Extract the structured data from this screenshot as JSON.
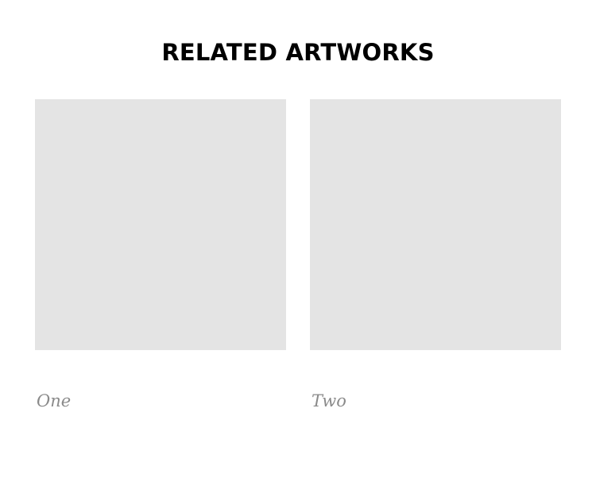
{
  "related": {
    "title": "RELATED ARTWORKS",
    "items": [
      {
        "caption": "One"
      },
      {
        "caption": "Two"
      }
    ]
  },
  "colors": {
    "thumbnail_placeholder": "#e4e4e4",
    "caption_text": "#8a8a8a",
    "title_text": "#000000"
  }
}
